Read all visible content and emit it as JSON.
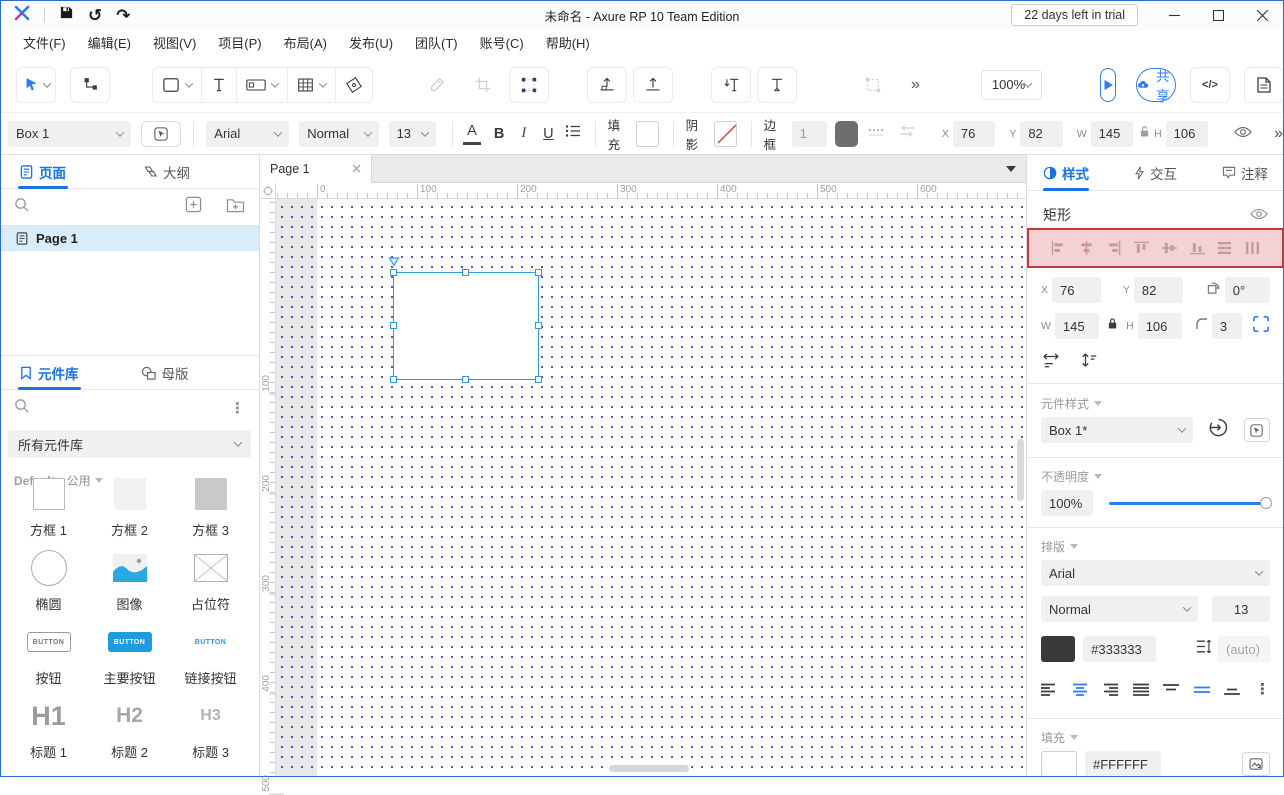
{
  "icons": {
    "undo": "↺",
    "redo": "↷",
    "more": "»",
    "dots": "⋮",
    "code": "</>",
    "tab_caret": "▼",
    "middot": "·"
  },
  "titlebar": {
    "title": "未命名 - Axure RP 10 Team Edition",
    "trial": "22 days left in trial"
  },
  "menu": {
    "items": [
      "文件(F)",
      "编辑(E)",
      "视图(V)",
      "项目(P)",
      "布局(A)",
      "发布(U)",
      "团队(T)",
      "账号(C)",
      "帮助(H)"
    ]
  },
  "toolbar": {
    "zoom": "100%",
    "share": "共享"
  },
  "format": {
    "style": "Box 1",
    "font": "Arial",
    "weight": "Normal",
    "size": "13",
    "a": "A",
    "b": "B",
    "i": "I",
    "u": "U",
    "fill": "填充",
    "shadow": "阴影",
    "border": "边框",
    "border_width": "1",
    "x_label": "X",
    "x": "76",
    "y_label": "Y",
    "y": "82",
    "w_label": "W",
    "w": "145",
    "h_label": "H",
    "h": "106"
  },
  "pages": {
    "tab_pages": "页面",
    "tab_outline": "大纲",
    "rows": [
      {
        "label": "Page 1"
      }
    ]
  },
  "widgets": {
    "tab_widgets": "元件库",
    "tab_masters": "母版",
    "library": "所有元件库",
    "group": "Default",
    "group_sub": "公用",
    "button_text": "BUTTON",
    "items": [
      {
        "label": "方框 1"
      },
      {
        "label": "方框 2"
      },
      {
        "label": "方框 3"
      },
      {
        "label": "椭圆"
      },
      {
        "label": "图像"
      },
      {
        "label": "占位符"
      },
      {
        "label": "按钮"
      },
      {
        "label": "主要按钮"
      },
      {
        "label": "链接按钮"
      },
      {
        "label": "标题 1",
        "glyph": "H1"
      },
      {
        "label": "标题 2",
        "glyph": "H2"
      },
      {
        "label": "标题 3",
        "glyph": "H3"
      }
    ]
  },
  "canvas": {
    "tab": "Page 1",
    "h_ruler": [
      "0",
      "100",
      "200",
      "300",
      "400",
      "500",
      "600"
    ],
    "v_ruler": [
      "100",
      "200",
      "300",
      "400",
      "500"
    ]
  },
  "panel": {
    "tab_style": "样式",
    "tab_interaction": "交互",
    "tab_notes": "注释",
    "shape": "矩形",
    "x_label": "X",
    "x": "76",
    "y_label": "Y",
    "y": "82",
    "rotation": "0°",
    "w_label": "W",
    "w": "145",
    "h_label": "H",
    "h": "106",
    "radius": "3",
    "widget_style_label": "元件样式",
    "widget_style": "Box 1*",
    "opacity_label": "不透明度",
    "opacity": "100%",
    "typography_label": "排版",
    "font": "Arial",
    "weight": "Normal",
    "size": "13",
    "color": "#333333",
    "line_height": "(auto)",
    "fill_label": "填充",
    "fill": "#FFFFFF"
  }
}
